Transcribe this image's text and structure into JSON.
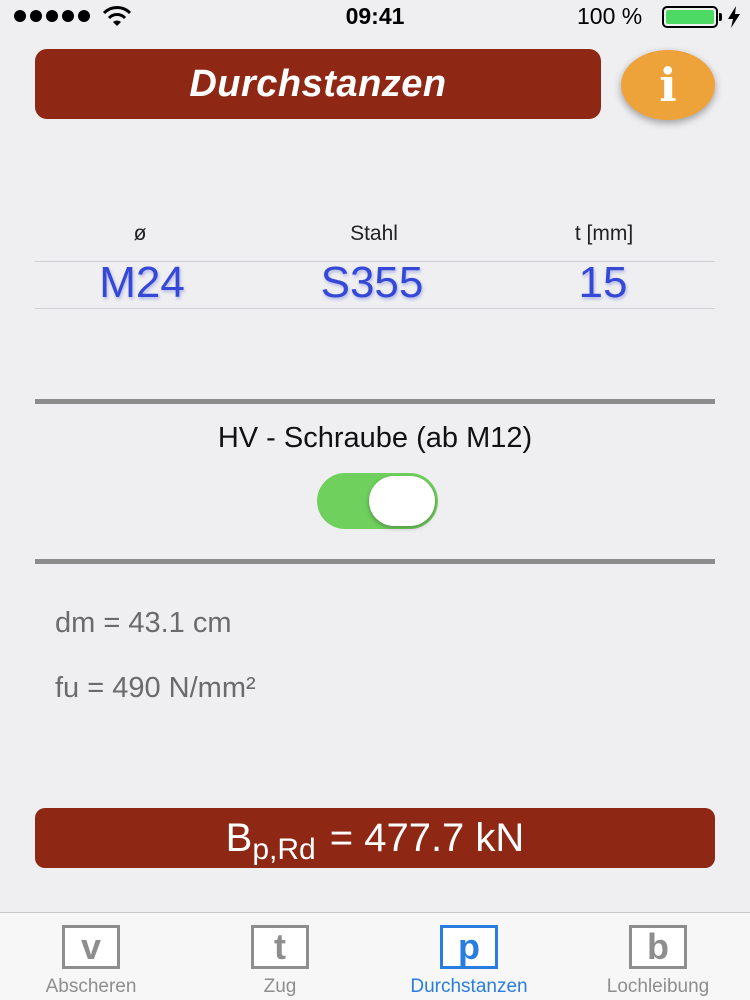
{
  "status_bar": {
    "time": "09:41",
    "battery_percent": "100 %",
    "battery_level": 1.0,
    "battery_color": "#4cd964"
  },
  "header": {
    "title": "Durchstanzen",
    "info_icon": "info-icon",
    "info_glyph": "i"
  },
  "picker": {
    "columns": [
      {
        "header": "ø",
        "value": "M24"
      },
      {
        "header": "Stahl",
        "value": "S355"
      },
      {
        "header": "t [mm]",
        "value": "15"
      }
    ]
  },
  "hv": {
    "label": "HV - Schraube (ab M12)",
    "toggle_on": true,
    "toggle_color": "#6fd05d"
  },
  "results": {
    "dm": "dm = 43.1 cm",
    "fu": "fu = 490 N/mm²"
  },
  "result_banner": {
    "symbol": "B",
    "subscript": "p,Rd",
    "value": "= 477.7 kN"
  },
  "tabs": [
    {
      "icon_letter": "v",
      "label": "Abscheren",
      "active": false
    },
    {
      "icon_letter": "t",
      "label": "Zug",
      "active": false
    },
    {
      "icon_letter": "p",
      "label": "Durchstanzen",
      "active": true
    },
    {
      "icon_letter": "b",
      "label": "Lochleibung",
      "active": false
    }
  ],
  "colors": {
    "brand_red": "#8f2715",
    "info_orange": "#eea33a",
    "picker_blue": "#3548d6",
    "tab_active": "#2a7de0",
    "tab_inactive": "#8e8e8e"
  }
}
